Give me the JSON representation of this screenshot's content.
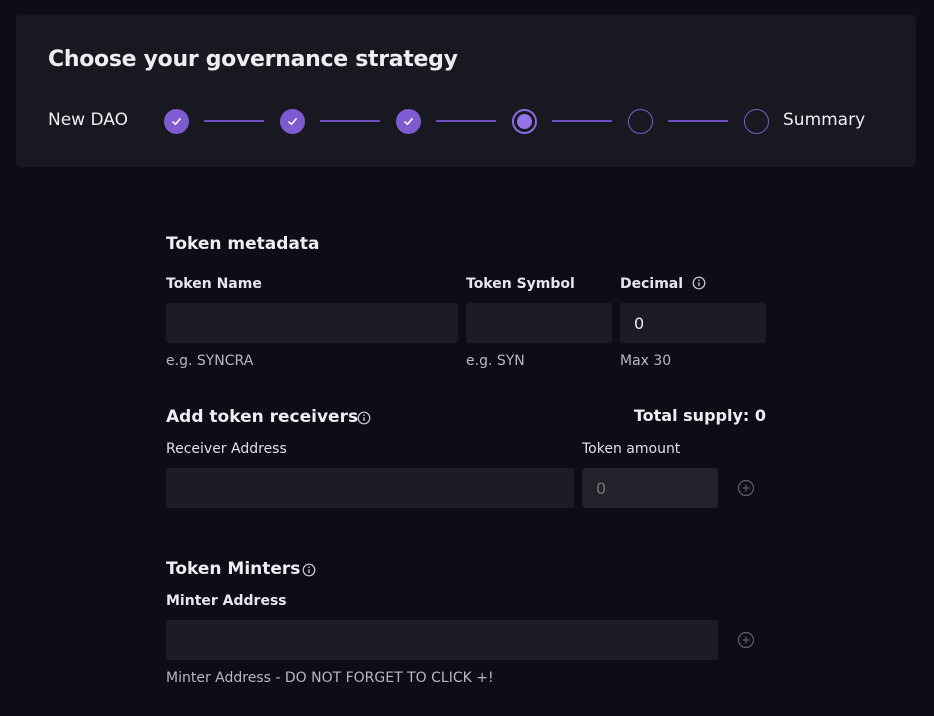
{
  "header": {
    "title": "Choose your governance strategy",
    "stepper": {
      "start_label": "New DAO",
      "end_label": "Summary",
      "steps": [
        "done",
        "done",
        "done",
        "current",
        "pending",
        "pending"
      ]
    }
  },
  "token_metadata": {
    "title": "Token metadata",
    "name_label": "Token Name",
    "name_value": "",
    "name_hint": "e.g. SYNCRA",
    "symbol_label": "Token Symbol",
    "symbol_value": "",
    "symbol_hint": "e.g. SYN",
    "decimal_label": "Decimal",
    "decimal_value": "0",
    "decimal_hint": "Max 30"
  },
  "receivers": {
    "title": "Add token receivers",
    "total_supply": "Total supply: 0",
    "address_label": "Receiver Address",
    "address_value": "",
    "amount_label": "Token amount",
    "amount_placeholder": "0"
  },
  "minters": {
    "title": "Token Minters",
    "address_label": "Minter Address",
    "address_value": "",
    "hint": "Minter Address - DO NOT FORGET TO CLICK +!"
  },
  "colors": {
    "accent": "#7e5bd0",
    "background": "#0d0c17",
    "card": "#181820",
    "input": "#1c1c25"
  }
}
